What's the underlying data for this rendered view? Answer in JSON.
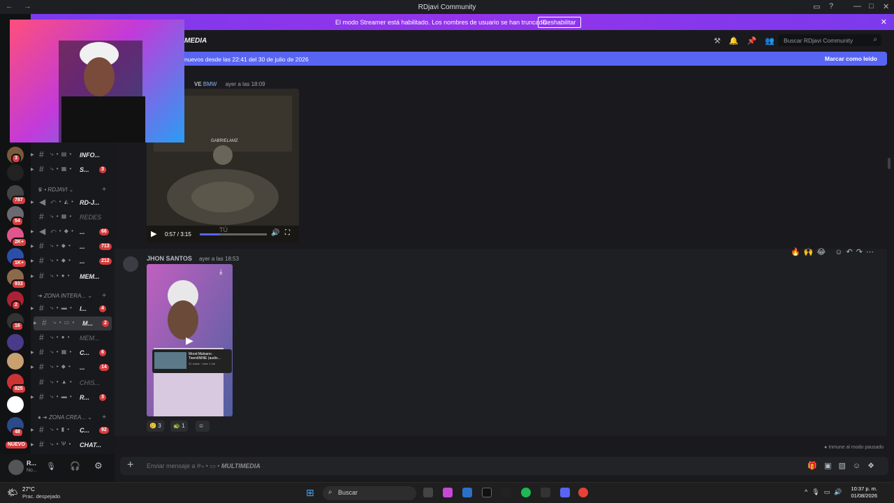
{
  "window": {
    "title": "RDjavi Community"
  },
  "banner": {
    "message": "El modo Streamer está habilitado. Los nombres de usuario se han truncado.",
    "disable_button": "Deshabilitar"
  },
  "header": {
    "channel": "MEDIA",
    "search_placeholder": "Buscar RDjavi Community"
  },
  "new_messages": {
    "label": "nuevos desde las 22:41 del 30 de julio de 2026",
    "mark_read": "Marcar como leído"
  },
  "server_badges": [
    "3",
    "787",
    "54",
    "2K+",
    "1K+",
    "933",
    "2",
    "16",
    "825",
    "48",
    "NUEVO"
  ],
  "categories": [
    {
      "label": "RDJAVI"
    },
    {
      "label": "ZONA INTERA..."
    },
    {
      "label": "ZONA CREA..."
    }
  ],
  "channels": [
    {
      "name": "INFO...",
      "count": ""
    },
    {
      "name": "S...",
      "count": "3"
    },
    {
      "name": "RD-J...",
      "count": ""
    },
    {
      "name": "REDES",
      "count": ""
    },
    {
      "name": "...",
      "count": "66"
    },
    {
      "name": "...",
      "count": "713"
    },
    {
      "name": "...",
      "count": "212"
    },
    {
      "name": "MEM...",
      "count": ""
    },
    {
      "name": "I...",
      "count": "4"
    },
    {
      "name": "M...",
      "count": "2"
    },
    {
      "name": "MEM...",
      "count": ""
    },
    {
      "name": "C...",
      "count": "6"
    },
    {
      "name": "...",
      "count": "14"
    },
    {
      "name": "CHIS...",
      "count": ""
    },
    {
      "name": "R...",
      "count": "3"
    },
    {
      "name": "C...",
      "count": "92"
    },
    {
      "name": "CHAT...",
      "count": ""
    }
  ],
  "user": {
    "name": "R...",
    "status": "No..."
  },
  "message1": {
    "author": "VE",
    "tag": "BMW",
    "time": "ayer a las 18:09",
    "video_time": "0:57 / 3:15",
    "video_label": "GABRIELAMZ",
    "video_overlay": "TÚ"
  },
  "message2": {
    "author": "JHON SANTOS",
    "time": "ayer a las 18:53",
    "card_title": "Mood Malsano · TwentiNINE (audio...",
    "card_sub": "31 vistas · hace 1 día",
    "reactions": [
      {
        "emoji": "🥲",
        "count": "3"
      },
      {
        "emoji": "🐢",
        "count": "1"
      }
    ]
  },
  "composer": {
    "placeholder": "Enviar mensaje a #",
    "channel": "MULTIMEDIA",
    "immune": "Inmune al modo pausado"
  },
  "taskbar": {
    "temp": "27°C",
    "weather": "Prac. despejado",
    "search": "Buscar",
    "time": "10:37 p. m.",
    "date": "01/08/2026"
  },
  "colors": {
    "accent": "#5865f2",
    "banner": "#9333ea",
    "badge": "#d83c3e"
  }
}
